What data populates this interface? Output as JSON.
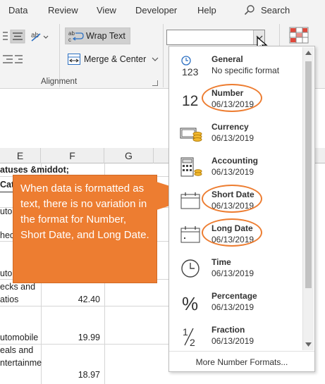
{
  "menu": {
    "tabs": [
      "Data",
      "Review",
      "View",
      "Developer",
      "Help"
    ],
    "search_label": "Search"
  },
  "ribbon": {
    "wrap_text": "Wrap Text",
    "merge_center": "Merge & Center",
    "alignment_group": "Alignment",
    "number_format_value": ""
  },
  "grid": {
    "columns": [
      "E",
      "F",
      "G"
    ],
    "cells": {
      "e1": "atuses &middot;",
      "e2": "Cat",
      "e3": "uto",
      "e4": "hec",
      "e5": "uto",
      "e6a": "ecks and",
      "e6b": "atios",
      "f6": "42.40",
      "e7": "utomobile",
      "f7": "19.99",
      "e8a": "eals and",
      "e8b": "ntertainme",
      "f8": "18.97"
    }
  },
  "callout": {
    "text": "When data is formatted as text, there is no variation in the format for Number, Short Date, and Long Date."
  },
  "number_formats": {
    "items": [
      {
        "name": "General",
        "sample": "No specific format",
        "icon": "general-123-icon"
      },
      {
        "name": "Number",
        "sample": "06/13/2019",
        "icon": "number-12-icon",
        "highlighted": true
      },
      {
        "name": "Currency",
        "sample": "06/13/2019",
        "icon": "currency-icon"
      },
      {
        "name": "Accounting",
        "sample": " 06/13/2019",
        "icon": "accounting-icon"
      },
      {
        "name": "Short Date",
        "sample": "06/13/2019",
        "icon": "short-date-calendar-icon",
        "highlighted": true
      },
      {
        "name": "Long Date",
        "sample": "06/13/2019",
        "icon": "long-date-calendar-icon",
        "highlighted": true
      },
      {
        "name": "Time",
        "sample": "06/13/2019",
        "icon": "clock-icon"
      },
      {
        "name": "Percentage",
        "sample": "06/13/2019",
        "icon": "percent-icon"
      },
      {
        "name": "Fraction",
        "sample": "06/13/2019",
        "icon": "fraction-icon"
      }
    ],
    "more_label": "More Number Formats..."
  },
  "colors": {
    "callout": "#ed7d31",
    "highlight_oval": "#ed7d31",
    "ribbon_bg": "#f3f3f3"
  }
}
